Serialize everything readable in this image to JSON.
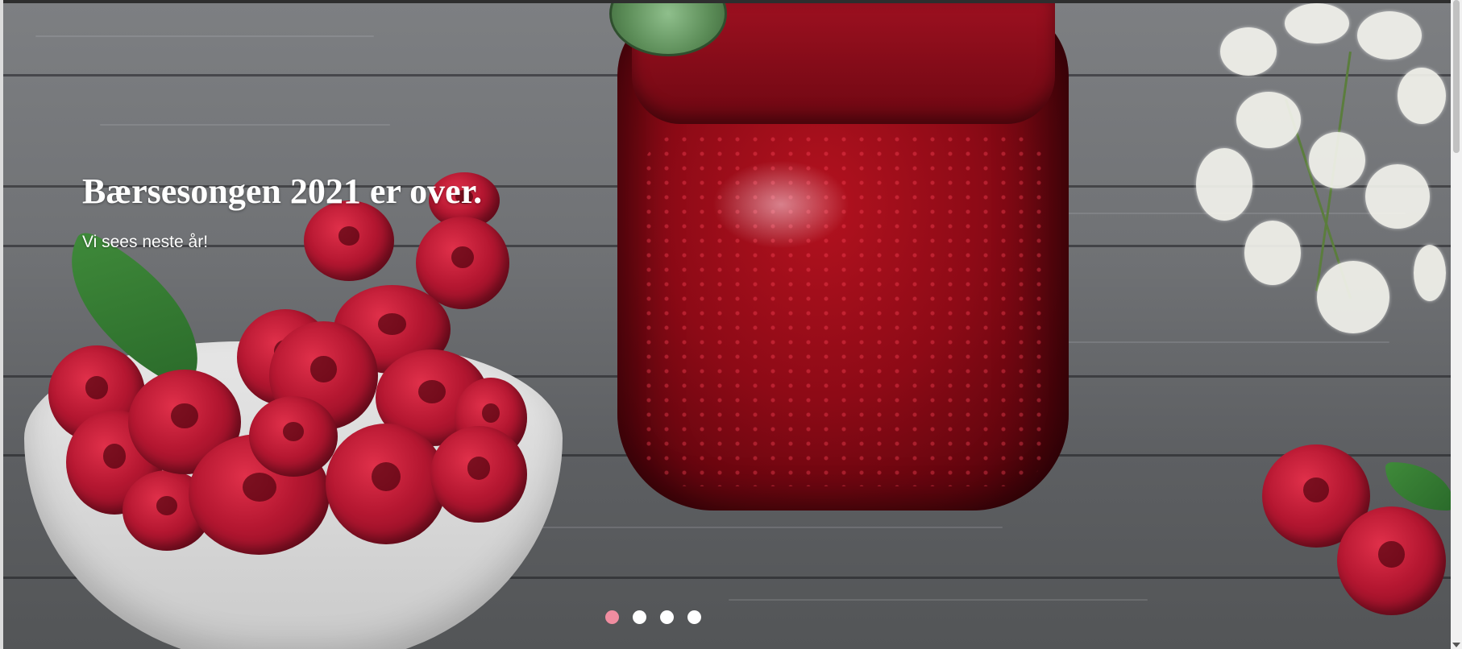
{
  "hero": {
    "title": "Bærsesongen 2021 er over.",
    "subtitle": "Vi sees neste år!",
    "background_image": "raspberry-jam-photo"
  },
  "carousel": {
    "slide_count": 4,
    "active_index": 0,
    "active_color": "#f08da0",
    "inactive_color": "#ffffff"
  },
  "scrollbar": {
    "thumb_color": "#c1c1c1"
  }
}
